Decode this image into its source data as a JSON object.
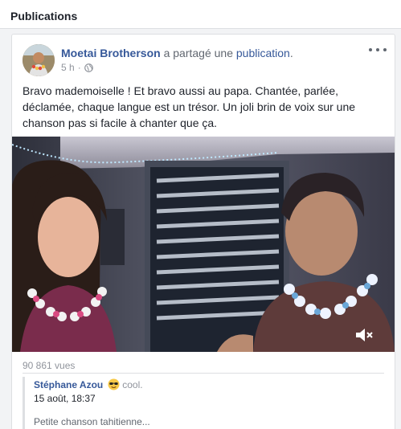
{
  "section": {
    "title": "Publications"
  },
  "post": {
    "author_name": "Moetai Brotherson",
    "shared_verb": " a partagé une ",
    "shared_link": "publication",
    "shared_period": ".",
    "timestamp": "5 h",
    "meta_separator": " · ",
    "audience_icon": "globe-icon",
    "more_icon": "more-horizontal-icon",
    "text": "Bravo mademoiselle ! Et bravo aussi au papa. Chantée, parlée, déclamée, chaque langue est un trésor. Un joli brin de voix sur une chanson pas si facile à chanter que ça.",
    "video": {
      "mute_icon": "speaker-muted-icon"
    },
    "views": "90 861 vues"
  },
  "comment": {
    "author": "Stéphane Azou",
    "emoji_icon": "sunglasses-emoji-icon",
    "emoji_text": "cool.",
    "date": "15 août, 18:37",
    "text": "Petite chanson tahitienne..."
  },
  "colors": {
    "link_blue": "#365899",
    "text_primary": "#1d2129",
    "text_secondary": "#90949c",
    "border": "#dddfe2",
    "page_bg": "#f2f3f5"
  }
}
